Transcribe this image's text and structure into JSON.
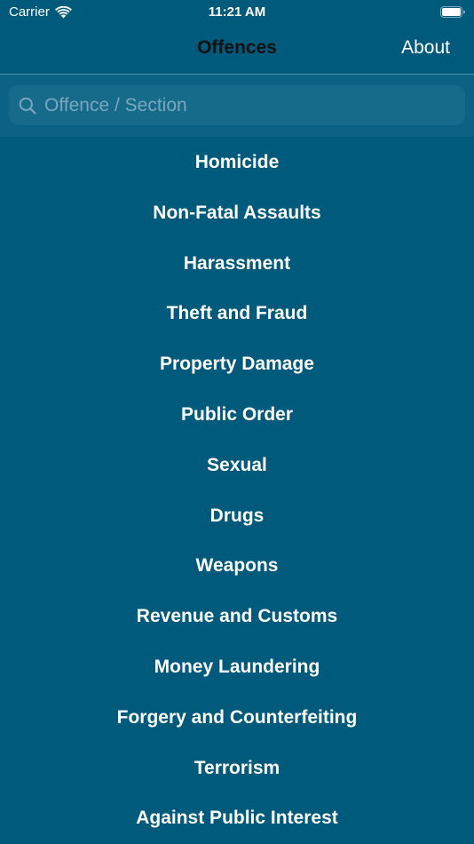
{
  "status_bar": {
    "carrier": "Carrier",
    "time": "11:21 AM",
    "icons": [
      "wifi-icon",
      "battery-icon"
    ]
  },
  "nav": {
    "title": "Offences",
    "about_label": "About"
  },
  "search": {
    "placeholder": "Offence / Section",
    "value": "",
    "icon": "search-icon"
  },
  "categories": [
    "Homicide",
    "Non-Fatal Assaults",
    "Harassment",
    "Theft and Fraud",
    "Property Damage",
    "Public Order",
    "Sexual",
    "Drugs",
    "Weapons",
    "Revenue and Customs",
    "Money Laundering",
    "Forgery and Counterfeiting",
    "Terrorism",
    "Against Public Interest"
  ],
  "colors": {
    "background": "#005a7c",
    "search_bar_background": "#0b6282",
    "search_field_background": "#166b8a",
    "title_text": "#111111",
    "text": "#ffffff"
  }
}
